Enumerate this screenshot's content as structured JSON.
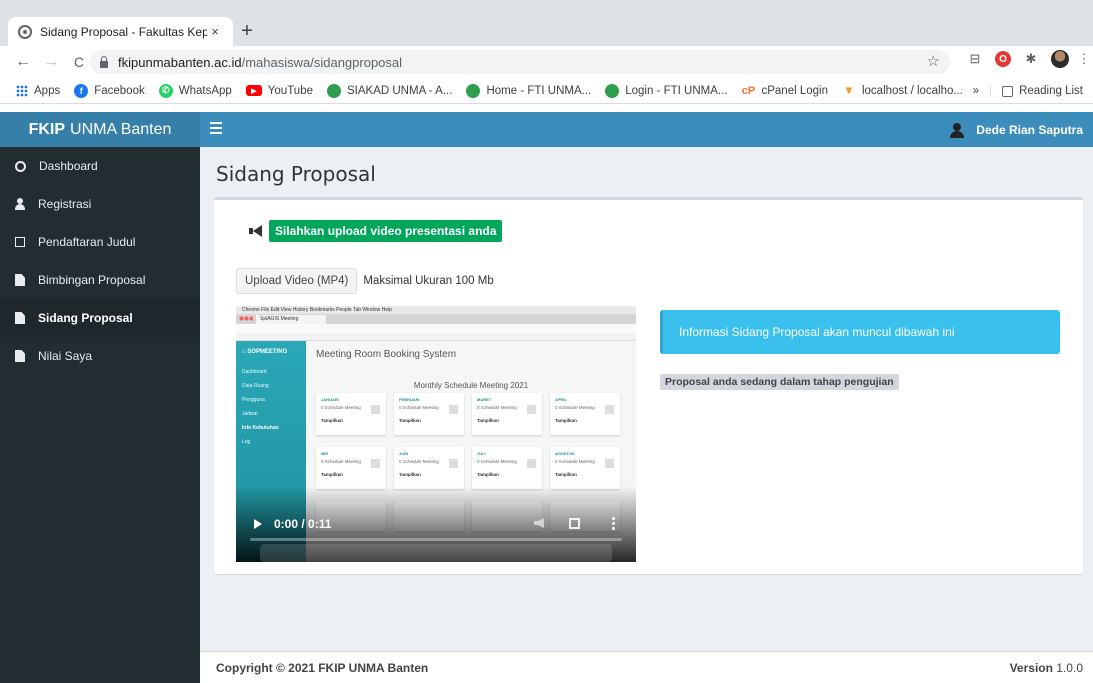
{
  "browser": {
    "tab_title": "Sidang Proposal - Fakultas Kep",
    "tab_close": "×",
    "new_tab": "+",
    "url_host": "fkipunmabanten.ac.id",
    "url_path": "/mahasiswa/sidangproposal",
    "back": "←",
    "forward": "→",
    "reload": "C",
    "star": "☆",
    "bookmarks": [
      {
        "label": "Apps",
        "icon": "apps-grid-icon",
        "color": "#1a73e8"
      },
      {
        "label": "Facebook",
        "icon": "facebook-icon",
        "color": "#1877f2"
      },
      {
        "label": "WhatsApp",
        "icon": "whatsapp-icon",
        "color": "#25d366"
      },
      {
        "label": "YouTube",
        "icon": "youtube-icon",
        "color": "#ff0000"
      },
      {
        "label": "SIAKAD UNMA - A...",
        "icon": "unma-icon",
        "color": "#2e9e4f"
      },
      {
        "label": "Home - FTI UNMA...",
        "icon": "unma-icon",
        "color": "#2e9e4f"
      },
      {
        "label": "Login - FTI UNMA...",
        "icon": "unma-icon",
        "color": "#2e9e4f"
      },
      {
        "label": "cPanel Login",
        "icon": "cpanel-icon",
        "color": "#ff6c2c"
      },
      {
        "label": "localhost / localho...",
        "icon": "phpmyadmin-icon",
        "color": "#f29111"
      }
    ],
    "overflow": "»",
    "reading_list": "Reading List"
  },
  "navbar": {
    "brand_bold": "FKIP",
    "brand_rest": "UNMA Banten",
    "user_name": "Dede Rian Saputra"
  },
  "sidebar": {
    "items": [
      {
        "label": "Dashboard",
        "icon": "dashboard-icon"
      },
      {
        "label": "Registrasi",
        "icon": "user-icon"
      },
      {
        "label": "Pendaftaran Judul",
        "icon": "edit-icon"
      },
      {
        "label": "Bimbingan Proposal",
        "icon": "file-icon"
      },
      {
        "label": "Sidang Proposal",
        "icon": "file-icon",
        "active": true
      },
      {
        "label": "Nilai Saya",
        "icon": "file-icon"
      }
    ]
  },
  "main": {
    "page_title": "Sidang Proposal",
    "notice": "Silahkan upload video presentasi anda",
    "upload_button": "Upload Video (MP4)",
    "upload_hint": "Maksimal Ukuran 100 Mb",
    "info_callout": "Informasi Sidang Proposal akan muncul dibawah ini",
    "status_label": "Proposal anda sedang dalam tahap pengujian",
    "colors": {
      "primary": "#3c8dbc",
      "success": "#00a65a",
      "info": "#39c0ed",
      "sidebar": "#222d32"
    }
  },
  "video": {
    "time": "0:00 / 0:11",
    "progress": 0,
    "screen_title": "Meeting Room Booking System",
    "screen_subtitle": "Monthly Schedule Meeting 2021",
    "screen_menu": " Chrome   File   Edit   View   History   Bookmarks   People   Tab   Window   Help",
    "screen_tab": "SplAGIS Meeting",
    "screen_brand": "SOPMEETING",
    "screen_side_items": [
      "Dashboard",
      "Data Ruang",
      "Pengguna",
      "Jadwal",
      "Info Kebutuhan",
      "Log"
    ],
    "screen_cards": [
      {
        "month": "JANUARI",
        "count": "0 Schedule Meeting",
        "action": "Tampilkan"
      },
      {
        "month": "FEBRUARI",
        "count": "0 Schedule Meeting",
        "action": "Tampilkan"
      },
      {
        "month": "MARET",
        "count": "0 Schedule Meeting",
        "action": "Tampilkan"
      },
      {
        "month": "APRIL",
        "count": "0 Schedule Meeting",
        "action": "Tampilkan"
      },
      {
        "month": "MEI",
        "count": "0 Schedule Meeting",
        "action": "Tampilkan"
      },
      {
        "month": "JUNI",
        "count": "0 Schedule Meeting",
        "action": "Tampilkan"
      },
      {
        "month": "JULI",
        "count": "0 Schedule Meeting",
        "action": "Tampilkan"
      },
      {
        "month": "AGUSTUS",
        "count": "0 Schedule Meeting",
        "action": "Tampilkan"
      }
    ]
  },
  "footer": {
    "copyright": "Copyright © 2021 FKIP UNMA Banten",
    "version_label": "Version",
    "version_value": "1.0.0"
  }
}
